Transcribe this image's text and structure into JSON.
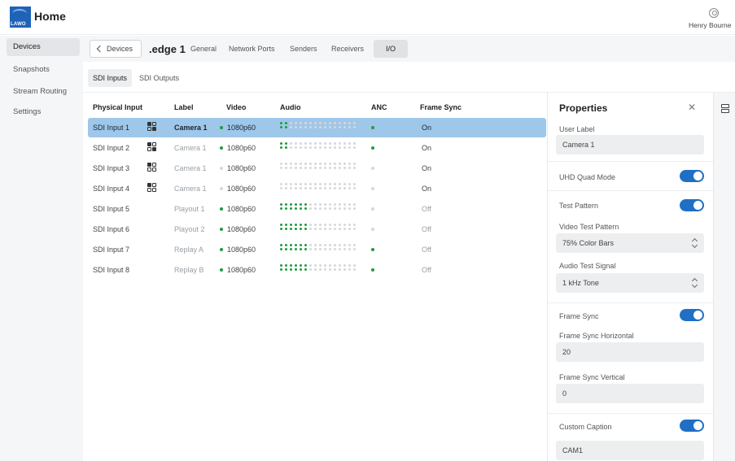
{
  "header": {
    "title": "Home",
    "logo_text": "LAWO",
    "user_name": "Henry Bourne"
  },
  "sidebar": {
    "items": [
      {
        "label": "Devices",
        "active": true
      },
      {
        "label": "Snapshots"
      },
      {
        "label": "Stream Routing"
      },
      {
        "label": "Settings"
      }
    ]
  },
  "topnav": {
    "back_label": "Devices",
    "device_name": ".edge 1",
    "tabs": [
      "General",
      "Network Ports",
      "Senders",
      "Receivers",
      "I/O"
    ],
    "active_tab": "I/O"
  },
  "subtabs": {
    "items": [
      "SDI Inputs",
      "SDI Outputs"
    ],
    "active": "SDI Inputs"
  },
  "table": {
    "columns": [
      "Physical Input",
      "Label",
      "Video",
      "Audio",
      "ANC",
      "Frame Sync"
    ],
    "rows": [
      {
        "input": "SDI Input 1",
        "label": "Camera 1",
        "video": "1080p60",
        "video_active": true,
        "audio_level": 2,
        "anc": true,
        "frame_sync": "On",
        "quad": true
      },
      {
        "input": "SDI Input 2",
        "label": "Camera 1",
        "video": "1080p60",
        "video_active": true,
        "audio_level": 2,
        "anc": true,
        "frame_sync": "On",
        "quad": true
      },
      {
        "input": "SDI Input 3",
        "label": "Camera 1",
        "video": "1080p60",
        "video_active": false,
        "audio_level": 0,
        "anc": false,
        "frame_sync": "On",
        "quad": true
      },
      {
        "input": "SDI Input 4",
        "label": "Camera 1",
        "video": "1080p60",
        "video_active": false,
        "audio_level": 0,
        "anc": false,
        "frame_sync": "On",
        "quad": true
      },
      {
        "input": "SDI Input 5",
        "label": "Playout 1",
        "video": "1080p60",
        "video_active": true,
        "audio_level": 6,
        "anc": false,
        "frame_sync": "Off",
        "quad": false
      },
      {
        "input": "SDI Input 6",
        "label": "Playout 2",
        "video": "1080p60",
        "video_active": true,
        "audio_level": 6,
        "anc": false,
        "frame_sync": "Off",
        "quad": false
      },
      {
        "input": "SDI Input 7",
        "label": "Replay A",
        "video": "1080p60",
        "video_active": true,
        "audio_level": 6,
        "anc": true,
        "frame_sync": "Off",
        "quad": false
      },
      {
        "input": "SDI Input 8",
        "label": "Replay B",
        "video": "1080p60",
        "video_active": true,
        "audio_level": 6,
        "anc": true,
        "frame_sync": "Off",
        "quad": false
      }
    ]
  },
  "properties": {
    "title": "Properties",
    "user_label": {
      "label": "User Label",
      "value": "Camera 1"
    },
    "uhd_quad_mode": {
      "label": "UHD Quad Mode",
      "on": true
    },
    "test_pattern": {
      "label": "Test Pattern",
      "on": true
    },
    "video_test_pattern": {
      "label": "Video Test Pattern",
      "value": "75% Color Bars"
    },
    "audio_test_signal": {
      "label": "Audio Test Signal",
      "value": "1 kHz Tone"
    },
    "frame_sync": {
      "label": "Frame Sync",
      "on": true
    },
    "frame_sync_horizontal": {
      "label": "Frame Sync Horizontal",
      "value": "20"
    },
    "frame_sync_vertical": {
      "label": "Frame Sync Vertical",
      "value": "0"
    },
    "custom_caption": {
      "label": "Custom Caption",
      "on": true,
      "value": "CAM1"
    }
  },
  "colors": {
    "accent": "#1f6fc5",
    "selected_row": "#9ec7ea",
    "signal_green": "#1f9b3e",
    "inactive": "#d5d8dc"
  }
}
